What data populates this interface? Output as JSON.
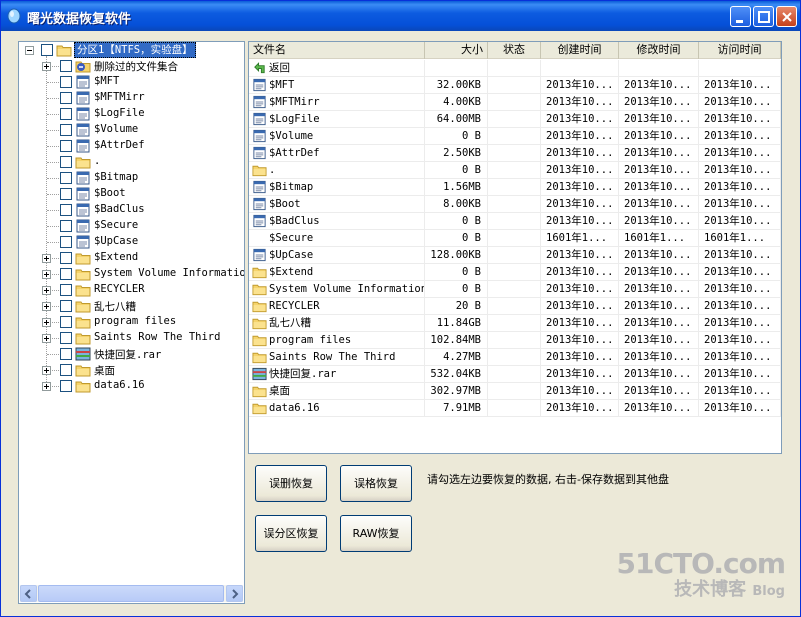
{
  "window": {
    "title": "曙光数据恢复软件"
  },
  "tree": {
    "root": "分区1【NTFS，实验盘】",
    "items": [
      {
        "label": "删除过的文件集合",
        "icon": "deleted-folder-icon",
        "expander": true
      },
      {
        "label": "$MFT",
        "icon": "file-icon",
        "expander": false
      },
      {
        "label": "$MFTMirr",
        "icon": "file-icon",
        "expander": false
      },
      {
        "label": "$LogFile",
        "icon": "file-icon",
        "expander": false
      },
      {
        "label": "$Volume",
        "icon": "file-icon",
        "expander": false
      },
      {
        "label": "$AttrDef",
        "icon": "file-icon",
        "expander": false
      },
      {
        "label": ".",
        "icon": "folder-icon",
        "expander": false
      },
      {
        "label": "$Bitmap",
        "icon": "file-icon",
        "expander": false
      },
      {
        "label": "$Boot",
        "icon": "file-icon",
        "expander": false
      },
      {
        "label": "$BadClus",
        "icon": "file-icon",
        "expander": false
      },
      {
        "label": "$Secure",
        "icon": "file-icon",
        "expander": false
      },
      {
        "label": "$UpCase",
        "icon": "file-icon",
        "expander": false
      },
      {
        "label": "$Extend",
        "icon": "folder-icon",
        "expander": true
      },
      {
        "label": "System Volume Information",
        "icon": "folder-icon",
        "expander": true
      },
      {
        "label": "RECYCLER",
        "icon": "folder-icon",
        "expander": true
      },
      {
        "label": "乱七八糟",
        "icon": "folder-icon",
        "expander": true
      },
      {
        "label": "program files",
        "icon": "folder-icon",
        "expander": true
      },
      {
        "label": "Saints Row The Third",
        "icon": "folder-icon",
        "expander": true
      },
      {
        "label": "快捷回复.rar",
        "icon": "rar-icon",
        "expander": false
      },
      {
        "label": "桌面",
        "icon": "folder-icon",
        "expander": true
      },
      {
        "label": "data6.16",
        "icon": "folder-icon",
        "expander": true
      }
    ]
  },
  "list": {
    "columns": [
      "文件名",
      "大小",
      "状态",
      "创建时间",
      "修改时间",
      "访问时间"
    ],
    "rows": [
      {
        "name": "返回",
        "size": "",
        "status": "",
        "created": "",
        "modified": "",
        "accessed": "",
        "icon": "back-icon"
      },
      {
        "name": "$MFT",
        "size": "32.00KB",
        "status": "",
        "created": "2013年10...",
        "modified": "2013年10...",
        "accessed": "2013年10...",
        "icon": "file-icon"
      },
      {
        "name": "$MFTMirr",
        "size": "4.00KB",
        "status": "",
        "created": "2013年10...",
        "modified": "2013年10...",
        "accessed": "2013年10...",
        "icon": "file-icon"
      },
      {
        "name": "$LogFile",
        "size": "64.00MB",
        "status": "",
        "created": "2013年10...",
        "modified": "2013年10...",
        "accessed": "2013年10...",
        "icon": "file-icon"
      },
      {
        "name": "$Volume",
        "size": "0 B",
        "status": "",
        "created": "2013年10...",
        "modified": "2013年10...",
        "accessed": "2013年10...",
        "icon": "file-icon"
      },
      {
        "name": "$AttrDef",
        "size": "2.50KB",
        "status": "",
        "created": "2013年10...",
        "modified": "2013年10...",
        "accessed": "2013年10...",
        "icon": "file-icon"
      },
      {
        "name": ".",
        "size": "0 B",
        "status": "",
        "created": "2013年10...",
        "modified": "2013年10...",
        "accessed": "2013年10...",
        "icon": "folder-icon"
      },
      {
        "name": "$Bitmap",
        "size": "1.56MB",
        "status": "",
        "created": "2013年10...",
        "modified": "2013年10...",
        "accessed": "2013年10...",
        "icon": "file-icon"
      },
      {
        "name": "$Boot",
        "size": "8.00KB",
        "status": "",
        "created": "2013年10...",
        "modified": "2013年10...",
        "accessed": "2013年10...",
        "icon": "file-icon"
      },
      {
        "name": "$BadClus",
        "size": "0 B",
        "status": "",
        "created": "2013年10...",
        "modified": "2013年10...",
        "accessed": "2013年10...",
        "icon": "file-icon"
      },
      {
        "name": "$Secure",
        "size": "0 B",
        "status": "",
        "created": "1601年1...",
        "modified": "1601年1...",
        "accessed": "1601年1...",
        "icon": ""
      },
      {
        "name": "$UpCase",
        "size": "128.00KB",
        "status": "",
        "created": "2013年10...",
        "modified": "2013年10...",
        "accessed": "2013年10...",
        "icon": "file-icon"
      },
      {
        "name": "$Extend",
        "size": "0 B",
        "status": "",
        "created": "2013年10...",
        "modified": "2013年10...",
        "accessed": "2013年10...",
        "icon": "folder-icon"
      },
      {
        "name": "System Volume Information",
        "size": "0 B",
        "status": "",
        "created": "2013年10...",
        "modified": "2013年10...",
        "accessed": "2013年10...",
        "icon": "folder-icon"
      },
      {
        "name": "RECYCLER",
        "size": "20 B",
        "status": "",
        "created": "2013年10...",
        "modified": "2013年10...",
        "accessed": "2013年10...",
        "icon": "folder-icon"
      },
      {
        "name": "乱七八糟",
        "size": "11.84GB",
        "status": "",
        "created": "2013年10...",
        "modified": "2013年10...",
        "accessed": "2013年10...",
        "icon": "folder-icon"
      },
      {
        "name": "program files",
        "size": "102.84MB",
        "status": "",
        "created": "2013年10...",
        "modified": "2013年10...",
        "accessed": "2013年10...",
        "icon": "folder-icon"
      },
      {
        "name": "Saints Row The Third",
        "size": "4.27MB",
        "status": "",
        "created": "2013年10...",
        "modified": "2013年10...",
        "accessed": "2013年10...",
        "icon": "folder-icon"
      },
      {
        "name": "快捷回复.rar",
        "size": "532.04KB",
        "status": "",
        "created": "2013年10...",
        "modified": "2013年10...",
        "accessed": "2013年10...",
        "icon": "rar-icon"
      },
      {
        "name": "桌面",
        "size": "302.97MB",
        "status": "",
        "created": "2013年10...",
        "modified": "2013年10...",
        "accessed": "2013年10...",
        "icon": "folder-icon"
      },
      {
        "name": "data6.16",
        "size": "7.91MB",
        "status": "",
        "created": "2013年10...",
        "modified": "2013年10...",
        "accessed": "2013年10...",
        "icon": "folder-icon"
      }
    ]
  },
  "buttons": {
    "undelete": "误删恢复",
    "unformat": "误格恢复",
    "partition": "误分区恢复",
    "raw": "RAW恢复"
  },
  "hint": "请勾选左边要恢复的数据, 右击-保存数据到其他盘",
  "watermark": {
    "line1": "51CTO.com",
    "line2": "技术博客",
    "line3": "Blog"
  },
  "colors": {
    "title": "#0a5cd8",
    "selection": "#316ac5",
    "folder": "#f5d36b"
  }
}
